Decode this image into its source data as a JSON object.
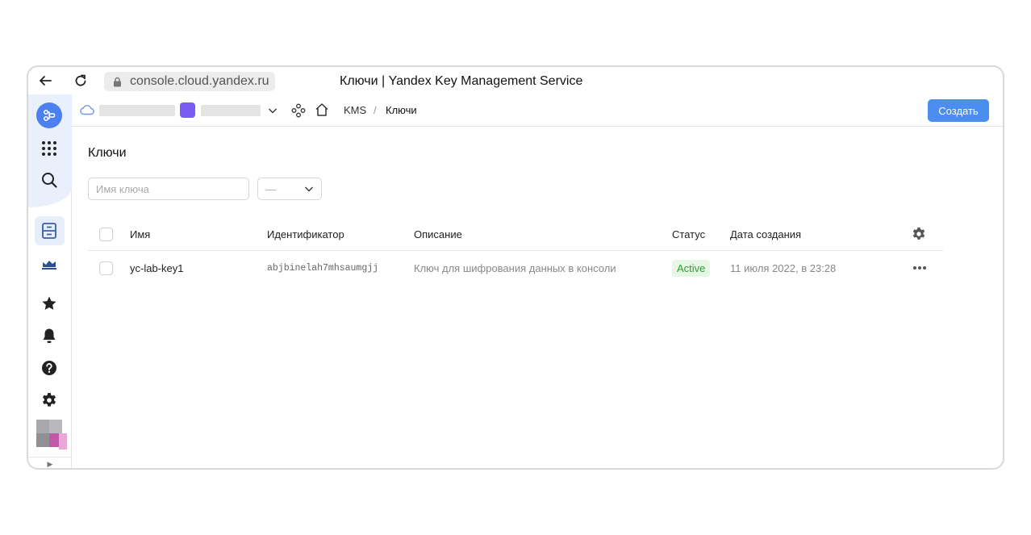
{
  "browser": {
    "url": "console.cloud.yandex.ru",
    "page_title": "Ключи | Yandex Key Management Service"
  },
  "breadcrumb": {
    "service": "KMS",
    "separator": "/",
    "page": "Ключи"
  },
  "header": {
    "create_label": "Создать"
  },
  "main": {
    "heading": "Ключи",
    "search_placeholder": "Имя ключа",
    "status_filter_value": "—"
  },
  "table": {
    "columns": [
      "Имя",
      "Идентификатор",
      "Описание",
      "Статус",
      "Дата создания"
    ],
    "rows": [
      {
        "name": "yc-lab-key1",
        "id": "abjbinelah7mhsaumgjj",
        "description": "Ключ для шифрования данных в консоли",
        "status": "Active",
        "created": "11 июля 2022, в 23:28"
      }
    ]
  },
  "colors": {
    "accent": "#4b8ef0",
    "status_active_bg": "#e7f7e5",
    "status_active_text": "#2f9c31"
  }
}
